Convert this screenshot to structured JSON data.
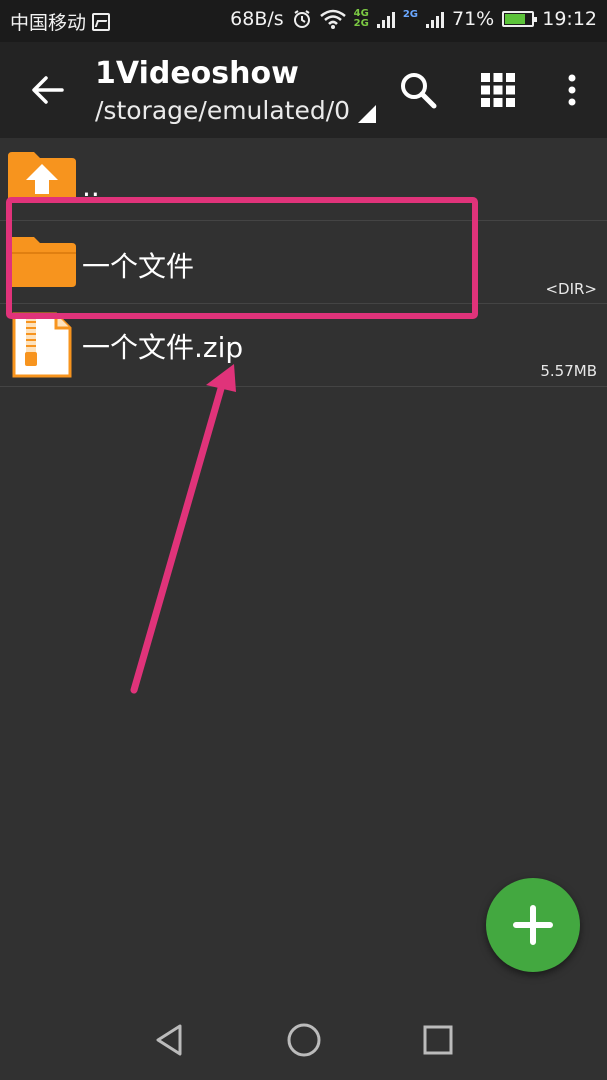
{
  "status": {
    "carrier": "中国移动",
    "speed": "68B/s",
    "net_4g": "4G",
    "net_2g": "2G",
    "net_2g_b": "2G",
    "battery": "71%",
    "time": "19:12"
  },
  "toolbar": {
    "title": "1Videoshow",
    "path": "/storage/emulated/0"
  },
  "files": [
    {
      "name": "..",
      "meta": ""
    },
    {
      "name": "一个文件",
      "meta": "<DIR>"
    },
    {
      "name": "一个文件.zip",
      "meta": "5.57MB"
    }
  ],
  "colors": {
    "accent": "#e0337a",
    "folder": "#f7941e",
    "fab": "#43a840"
  }
}
